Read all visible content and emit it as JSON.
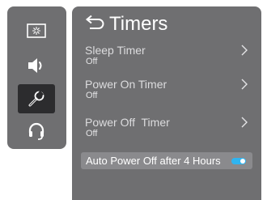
{
  "sidebar": {
    "items": [
      {
        "icon": "picture-settings-icon",
        "active": false
      },
      {
        "icon": "speaker-icon",
        "active": false
      },
      {
        "icon": "wrench-icon",
        "active": true
      },
      {
        "icon": "headset-icon",
        "active": false
      }
    ]
  },
  "panel": {
    "title": "Timers",
    "back_icon": "back-arrow-icon",
    "items": [
      {
        "label": "Sleep Timer",
        "value": "Off"
      },
      {
        "label": "Power On Timer",
        "value": "Off"
      },
      {
        "label": "Power Off  Timer",
        "value": "Off"
      }
    ],
    "toggle": {
      "label": "Auto Power Off after 4 Hours",
      "state": "on"
    }
  },
  "colors": {
    "panel_bg": "#6f6f71",
    "active_bg": "#2c2c2e",
    "toggle_on": "#2fb4f0"
  }
}
